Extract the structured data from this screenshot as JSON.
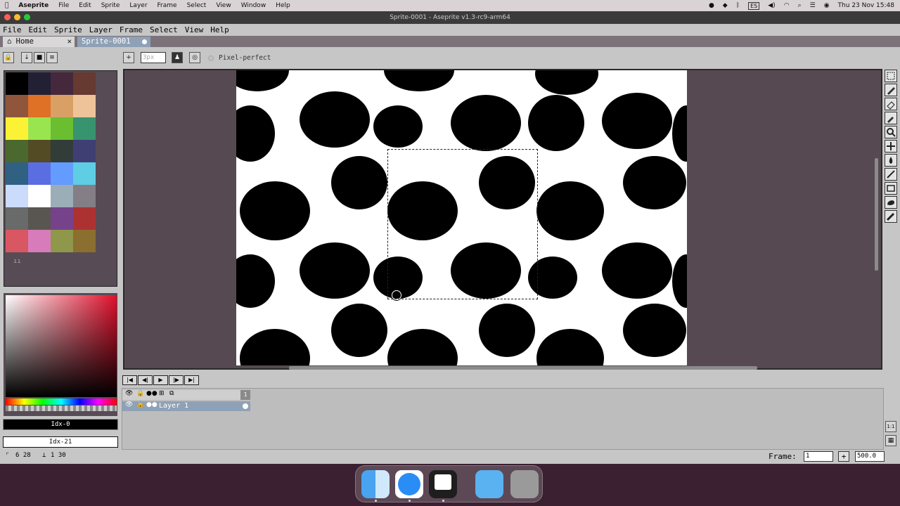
{
  "macos_menubar": {
    "app": "Aseprite",
    "items": [
      "File",
      "Edit",
      "Sprite",
      "Layer",
      "Frame",
      "Select",
      "View",
      "Window",
      "Help"
    ],
    "keyboard_layout": "ES",
    "clock": "Thu 23 Nov  15:48"
  },
  "window": {
    "title": "Sprite-0001 - Aseprite v1.3-rc9-arm64"
  },
  "app_menu": {
    "items": [
      "File",
      "Edit",
      "Sprite",
      "Layer",
      "Frame",
      "Select",
      "View",
      "Help"
    ]
  },
  "tabs": [
    {
      "label": "Home",
      "close": "✕"
    },
    {
      "label": "Sprite-0001"
    }
  ],
  "context_bar": {
    "brush_size": "3px",
    "pixel_perfect_label": "Pixel-perfect"
  },
  "palette": {
    "colors": [
      "#000000",
      "#222034",
      "#45283c",
      "#663931",
      "#8f563b",
      "#df7126",
      "#d9a066",
      "#eec39a",
      "#fbf236",
      "#99e550",
      "#6abe30",
      "#37946e",
      "#4b692f",
      "#524b24",
      "#323c39",
      "#3f3f74",
      "#306082",
      "#5b6ee1",
      "#639bff",
      "#5fcde4",
      "#cbdbfc",
      "#ffffff",
      "#9badb7",
      "#847e87",
      "#696a6a",
      "#595652",
      "#76428a",
      "#ac3232",
      "#d95763",
      "#d77bba",
      "#8f974a",
      "#8a6f30"
    ]
  },
  "color_indexes": {
    "fg": "Idx-0",
    "bg": "Idx-21"
  },
  "timeline": {
    "frame_header": "1",
    "layer_name": "Layer 1"
  },
  "status": {
    "cursor": "6 28",
    "selection_size": "1 30",
    "frame_label": "Frame:",
    "frame_value": "1",
    "zoom": "500.0"
  },
  "dock_apps": [
    "Finder",
    "Safari",
    "Aseprite",
    "Downloads",
    "Trash"
  ],
  "colors": {
    "accent_tab": "#8fa1b6",
    "canvas_bg": "#564951",
    "panel_bg": "#c6c6c6"
  }
}
